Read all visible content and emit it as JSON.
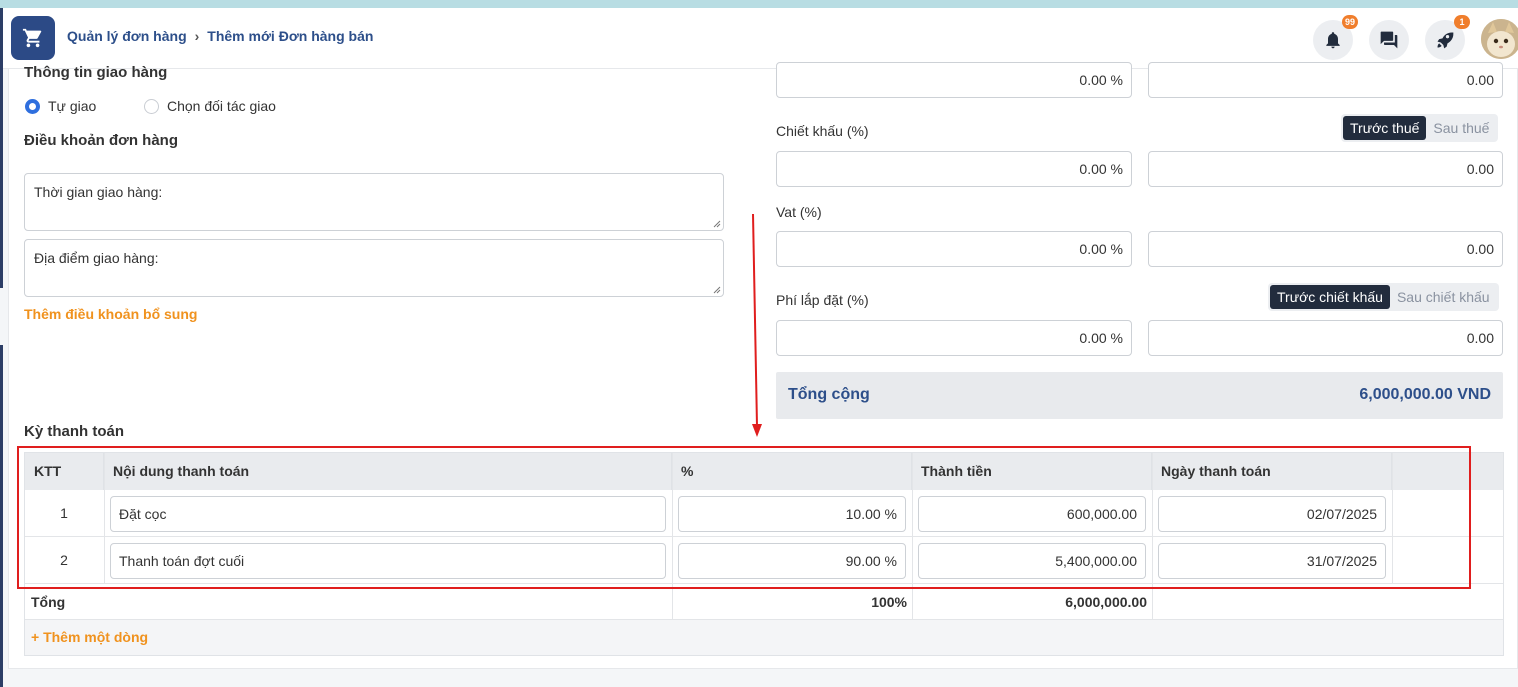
{
  "header": {
    "breadcrumb_parent": "Quản lý đơn hàng",
    "breadcrumb_current": "Thêm mới Đơn hàng bán",
    "notifications_badge": "99",
    "rocket_badge": "1"
  },
  "delivery": {
    "title": "Thông tin giao hàng",
    "option_self": "Tự giao",
    "option_partner": "Chọn đối tác giao",
    "selected": "Tự giao"
  },
  "terms": {
    "title": "Điều khoản đơn hàng",
    "delivery_time_placeholder": "Thời gian giao hàng:",
    "delivery_place_placeholder": "Địa điểm giao hàng:",
    "add_term_link": "Thêm điều khoản bổ sung"
  },
  "pricing": {
    "top_percent": "0.00 %",
    "top_amount": "0.00",
    "discount_label": "Chiết khấu (%)",
    "discount_percent": "0.00 %",
    "discount_amount": "0.00",
    "discount_toggle_active": "Trước thuế",
    "discount_toggle_inactive": "Sau thuế",
    "vat_label": "Vat (%)",
    "vat_percent": "0.00 %",
    "vat_amount": "0.00",
    "install_label": "Phí lắp đặt (%)",
    "install_percent": "0.00 %",
    "install_amount": "0.00",
    "install_toggle_active": "Trước chiết khấu",
    "install_toggle_inactive": "Sau chiết khấu",
    "total_label": "Tổng cộng",
    "total_value": "6,000,000.00 VND"
  },
  "payment": {
    "title": "Kỳ thanh toán",
    "columns": [
      "KTT",
      "Nội dung thanh toán",
      "%",
      "Thành tiền",
      "Ngày thanh toán"
    ],
    "rows": [
      {
        "ktt": "1",
        "content": "Đặt cọc",
        "percent": "10.00 %",
        "amount": "600,000.00",
        "date": "02/07/2025"
      },
      {
        "ktt": "2",
        "content": "Thanh toán đợt cuối",
        "percent": "90.00 %",
        "amount": "5,400,000.00",
        "date": "31/07/2025"
      }
    ],
    "footer_label": "Tổng",
    "footer_percent": "100%",
    "footer_amount": "6,000,000.00",
    "add_row_link": "+ Thêm một dòng"
  },
  "colors": {
    "brand": "#2c4a86",
    "accent_orange": "#f0921e",
    "highlight_red": "#e01e1e",
    "radio_blue": "#2f6fde"
  }
}
